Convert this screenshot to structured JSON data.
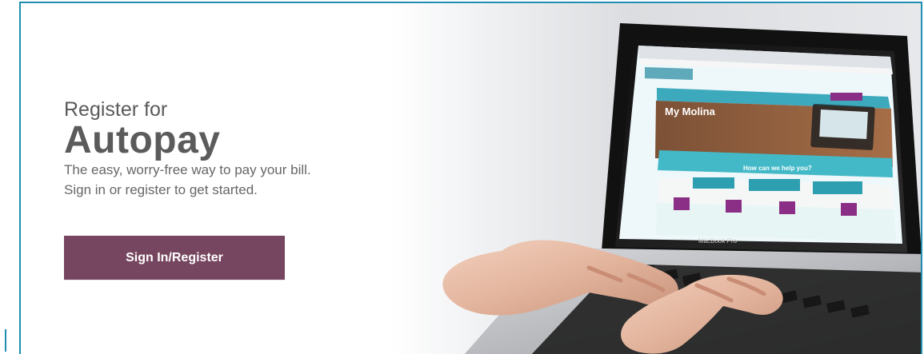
{
  "hero": {
    "kicker": "Register for",
    "headline": "Autopay",
    "subtitle_line1": "The easy, worry-free way to pay your bill.",
    "subtitle_line2": "Sign in or register to get started.",
    "button_label": "Sign In/Register"
  },
  "laptop": {
    "model_label": "MacBook Pro",
    "screen": {
      "promo_title": "My Molina",
      "help_heading": "How can we help you?"
    }
  },
  "colors": {
    "button": "#76455f",
    "border_accent": "#1d8fb0",
    "site_teal": "#39a7b7",
    "site_purple": "#8b2f86"
  },
  "icons": {
    "laptop": "laptop-illustration",
    "hands": "typing-hands-illustration"
  }
}
